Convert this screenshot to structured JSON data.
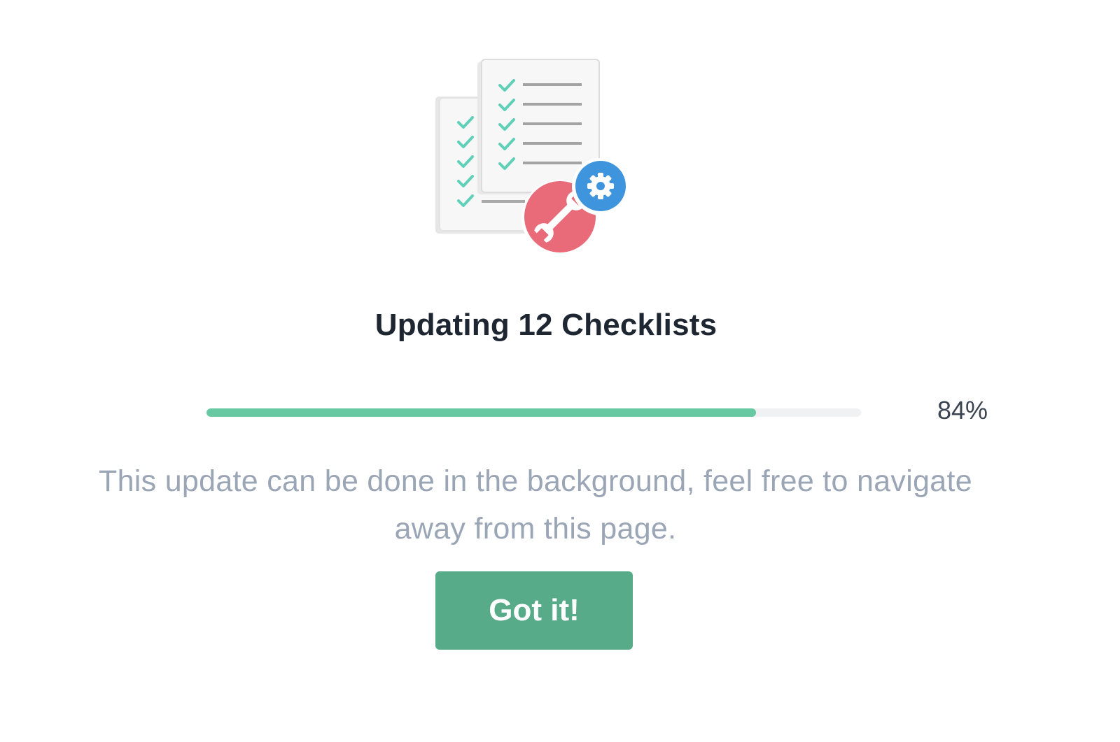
{
  "illustration": {
    "name": "checklists-update-illustration",
    "icons": [
      "checklist-document-icon",
      "wrench-icon",
      "gear-icon"
    ]
  },
  "dialog": {
    "title": "Updating 12 Checklists",
    "progress": {
      "percent": 84,
      "label": "84%"
    },
    "description": "This update can be done in the background, feel free to navigate away from this page.",
    "button_label": "Got it!"
  },
  "colors": {
    "accent_green": "#58ab88",
    "progress_green": "#66c9a1",
    "check_teal": "#5fd0b8",
    "wrench_red": "#e96a78",
    "gear_blue": "#3f95dd",
    "title": "#1e2632",
    "muted_text": "#9aa5b5"
  }
}
